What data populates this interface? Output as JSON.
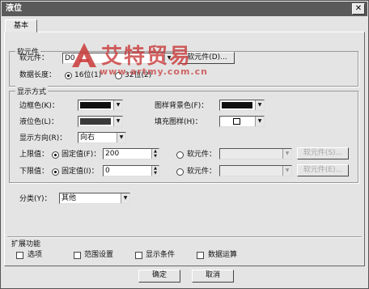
{
  "window": {
    "title": "液位",
    "close_glyph": "✕"
  },
  "tabs": [
    {
      "label": "基本",
      "active": true
    }
  ],
  "device_group": {
    "title": "软元件",
    "device_label": "软元件：",
    "device_value": "D0",
    "device_button": "软元件(D)...",
    "length_label": "数据长度：",
    "length_options": [
      {
        "label": "16位(1)",
        "selected": true
      },
      {
        "label": "32位(2)",
        "selected": false
      }
    ]
  },
  "display_group": {
    "title": "显示方式",
    "frame_color_label": "边框色(K)：",
    "frame_color": "#111111",
    "liquid_color_label": "液位色(L)：",
    "liquid_color": "#3a3a3a",
    "pattern_bg_label": "图样背景色(F)：",
    "pattern_bg_color": "#111111",
    "fill_pattern_label": "填充图样(H)：",
    "direction_label": "显示方向(R)：",
    "direction_value": "向右",
    "upper": {
      "label": "上限值：",
      "fixed_label": "固定值(F)：",
      "fixed_selected": true,
      "value": "200",
      "device_label": "软元件：",
      "device_value": "",
      "device_button": "软元件(S)..."
    },
    "lower": {
      "label": "下限值：",
      "fixed_label": "固定值(I)：",
      "fixed_selected": true,
      "value": "0",
      "device_label": "软元件：",
      "device_value": "",
      "device_button": "软元件(E)..."
    }
  },
  "category": {
    "label": "分类(Y)：",
    "value": "其他"
  },
  "extension_group": {
    "title": "扩展功能",
    "options": [
      {
        "label": "选项",
        "checked": false
      },
      {
        "label": "范围设置",
        "checked": false
      },
      {
        "label": "显示条件",
        "checked": false
      },
      {
        "label": "数据运算",
        "checked": false
      }
    ]
  },
  "footer": {
    "ok_label": "确定",
    "cancel_label": "取消"
  },
  "watermark": {
    "brand": "艾特贸易",
    "url": "www.artmy.com.cn",
    "color": "#c93a3a"
  }
}
